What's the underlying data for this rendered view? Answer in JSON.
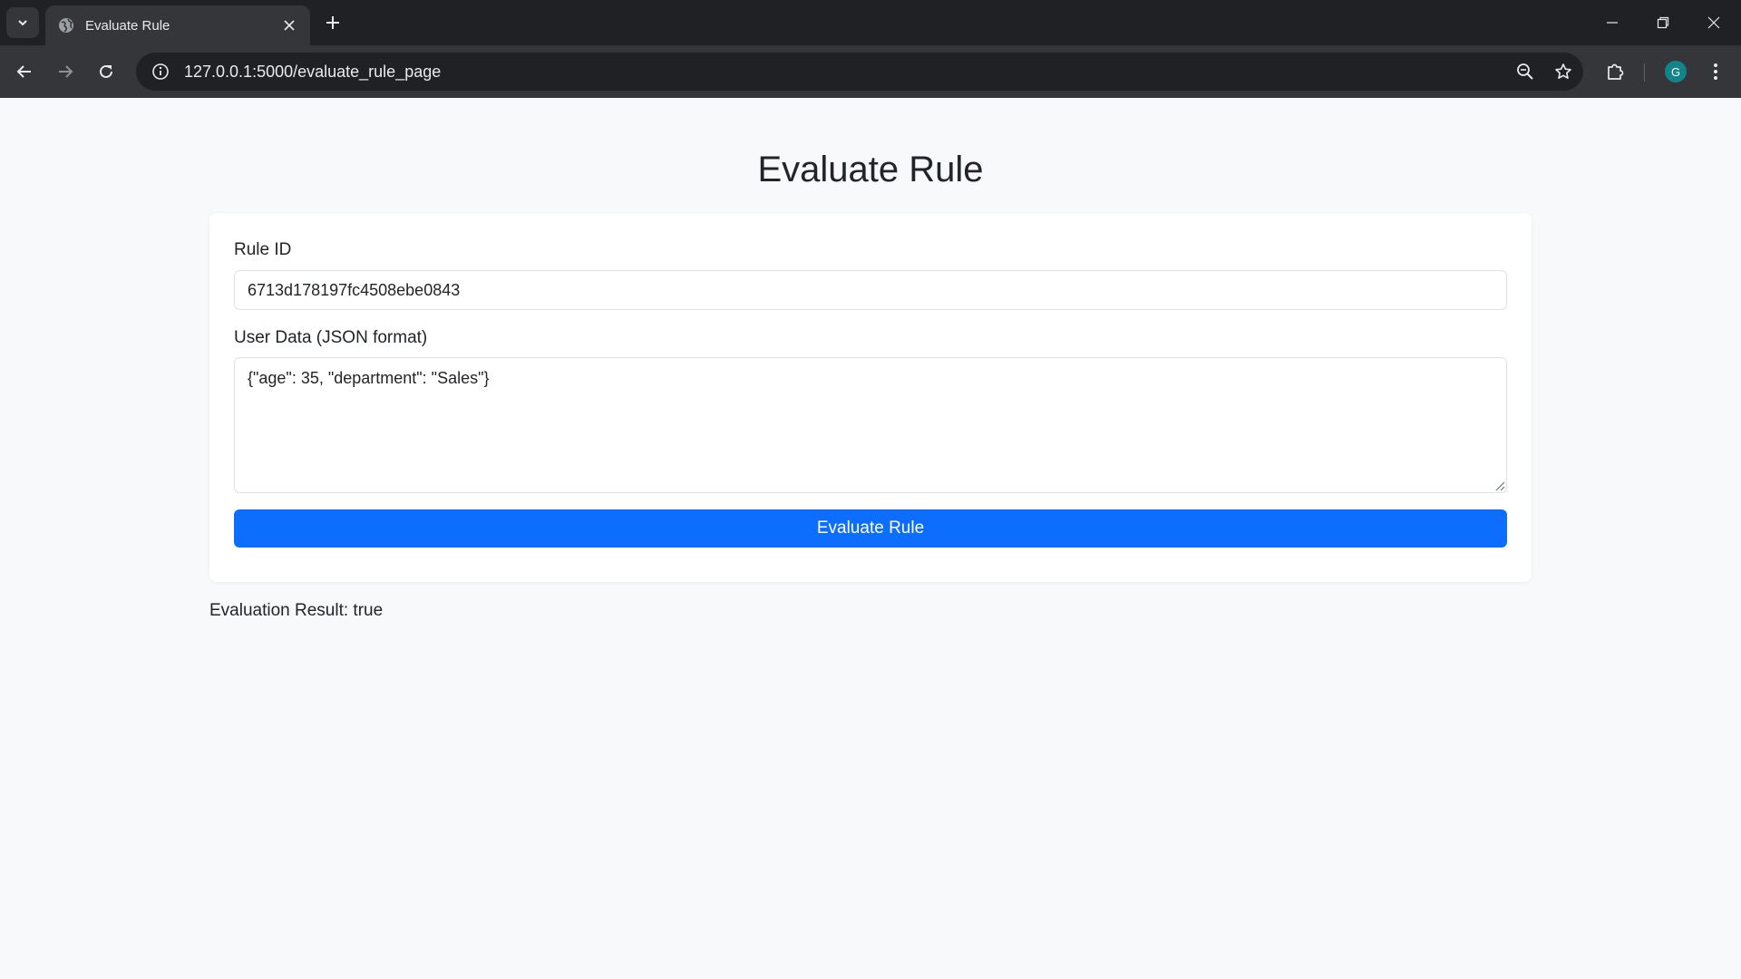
{
  "browser": {
    "tab_title": "Evaluate Rule",
    "url": "127.0.0.1:5000/evaluate_rule_page",
    "profile_initial": "G",
    "accent_color": "#11858a"
  },
  "page": {
    "title": "Evaluate Rule",
    "form": {
      "rule_id_label": "Rule ID",
      "rule_id_value": "6713d178197fc4508ebe0843",
      "user_data_label": "User Data (JSON format)",
      "user_data_value": "{\"age\": 35, \"department\": \"Sales\"}",
      "submit_label": "Evaluate Rule",
      "submit_color": "#0d6efd"
    },
    "result_text": "Evaluation Result: true"
  },
  "icons": {
    "tab_search": "chevron-down-icon",
    "favicon": "globe-icon",
    "tab_close": "close-icon",
    "new_tab": "plus-icon",
    "back": "arrow-left-icon",
    "forward": "arrow-right-icon",
    "reload": "reload-icon",
    "site_info": "info-icon",
    "zoom": "zoom-icon",
    "bookmark": "star-icon",
    "extensions": "puzzle-icon",
    "menu": "kebab-menu-icon",
    "minimize": "minimize-icon",
    "restore": "restore-icon",
    "close_window": "close-icon"
  }
}
